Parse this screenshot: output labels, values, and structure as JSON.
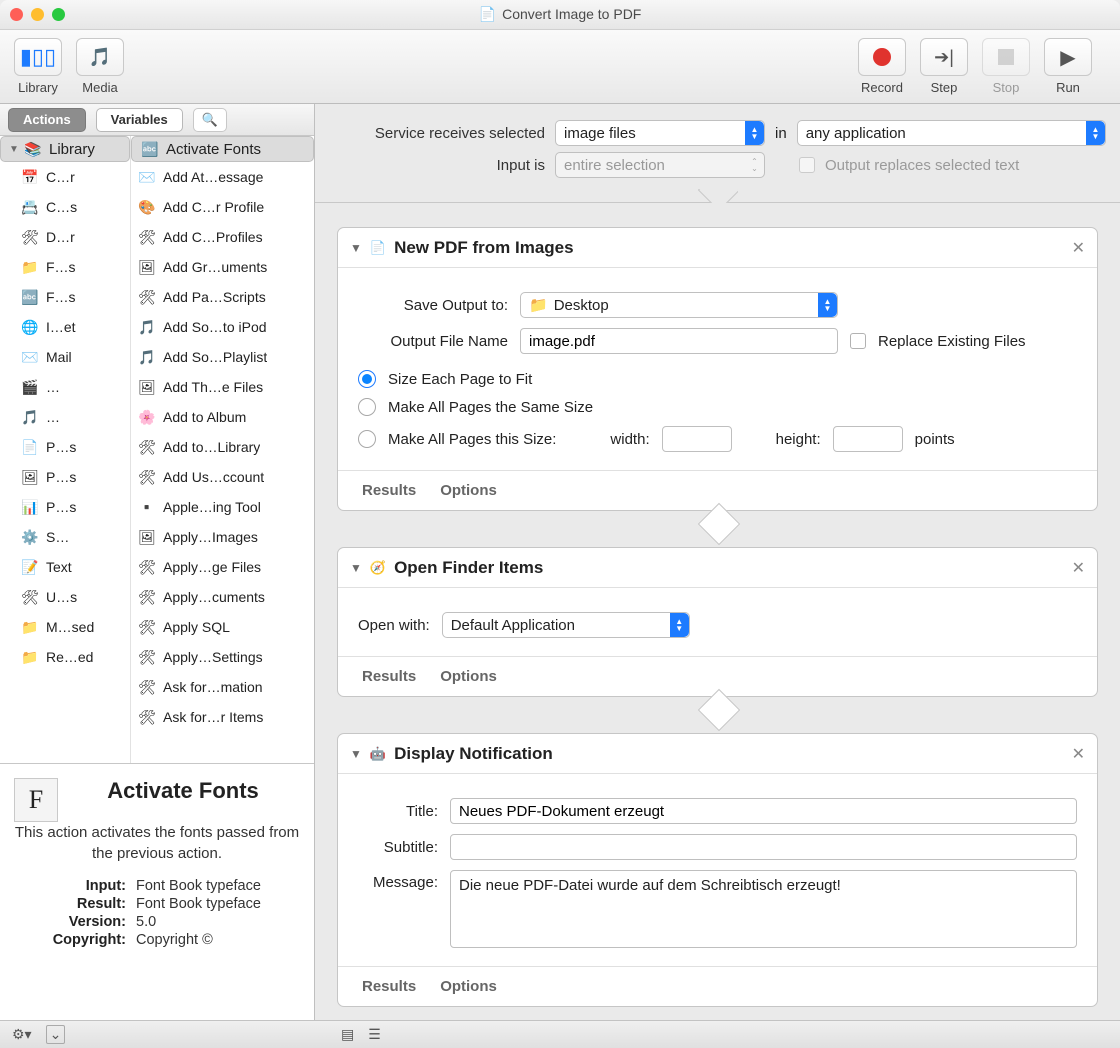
{
  "window_title": "Convert Image to PDF",
  "toolbar": {
    "library": "Library",
    "media": "Media",
    "record": "Record",
    "step": "Step",
    "stop": "Stop",
    "run": "Run"
  },
  "tabs": {
    "actions": "Actions",
    "variables": "Variables"
  },
  "library_col": [
    "Library",
    "C…r",
    "C…s",
    "D…r",
    "F…s",
    "F…s",
    "I…et",
    "Mail",
    "…",
    "…",
    "P…s",
    "P…s",
    "P…s",
    "S…",
    "Text",
    "U…s",
    "M…sed",
    "Re…ed"
  ],
  "actions_col": [
    "Activate Fonts",
    "Add At…essage",
    "Add C…r Profile",
    "Add C…Profiles",
    "Add Gr…uments",
    "Add Pa…Scripts",
    "Add So…to iPod",
    "Add So…Playlist",
    "Add Th…e Files",
    "Add to Album",
    "Add to…Library",
    "Add Us…ccount",
    "Apple…ing Tool",
    "Apply…Images",
    "Apply…ge Files",
    "Apply…cuments",
    "Apply SQL",
    "Apply…Settings",
    "Ask for…mation",
    "Ask for…r Items"
  ],
  "info": {
    "title": "Activate Fonts",
    "desc": "This action activates the fonts passed from the previous action.",
    "input_k": "Input:",
    "input_v": "Font Book typeface",
    "result_k": "Result:",
    "result_v": "Font Book typeface",
    "version_k": "Version:",
    "version_v": "5.0",
    "copyright_k": "Copyright:",
    "copyright_v": "Copyright ©"
  },
  "cfg": {
    "receives_lbl": "Service receives selected",
    "receives_val": "image files",
    "in_lbl": "in",
    "in_val": "any application",
    "inputis_lbl": "Input is",
    "inputis_val": "entire selection",
    "replace_lbl": "Output replaces selected text"
  },
  "card1": {
    "title": "New PDF from Images",
    "save_to_lbl": "Save Output to:",
    "save_to_val": "Desktop",
    "fname_lbl": "Output File Name",
    "fname_val": "image.pdf",
    "replace_lbl": "Replace Existing Files",
    "r1": "Size Each Page to Fit",
    "r2": "Make All Pages the Same Size",
    "r3": "Make All Pages this Size:",
    "width_lbl": "width:",
    "height_lbl": "height:",
    "unit": "points",
    "results": "Results",
    "options": "Options"
  },
  "card2": {
    "title": "Open Finder Items",
    "open_lbl": "Open with:",
    "open_val": "Default Application",
    "results": "Results",
    "options": "Options"
  },
  "card3": {
    "title": "Display Notification",
    "title_lbl": "Title:",
    "title_val": "Neues PDF-Dokument erzeugt",
    "sub_lbl": "Subtitle:",
    "sub_val": "",
    "msg_lbl": "Message:",
    "msg_val": "Die neue PDF-Datei wurde auf dem Schreibtisch erzeugt!",
    "results": "Results",
    "options": "Options"
  }
}
